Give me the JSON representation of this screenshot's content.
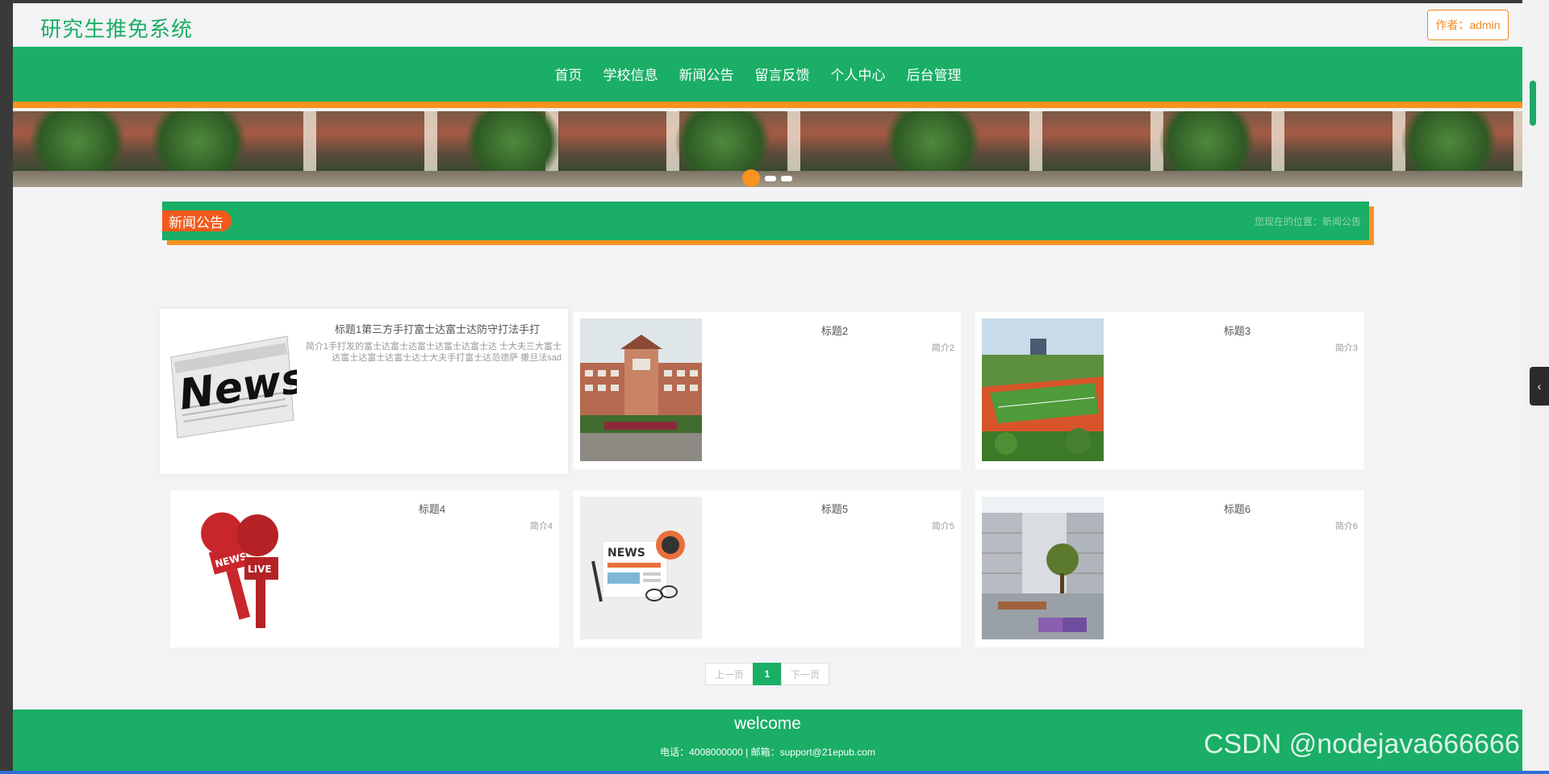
{
  "header": {
    "site_title": "研究生推免系统",
    "author_label": "作者：admin"
  },
  "nav": {
    "items": [
      "首页",
      "学校信息",
      "新闻公告",
      "留言反馈",
      "个人中心",
      "后台管理"
    ]
  },
  "banner": {
    "slide_count": 3,
    "active_index": 0
  },
  "section": {
    "tag": "新闻公告",
    "breadcrumb": "您现在的位置：新闻公告"
  },
  "news": [
    {
      "title": "标题1第三方手打富士达富士达防守打法手打",
      "summary": "简介1手打发的富士达富士达富士达富士达富士达 士大夫三大富士达富士达富士达富士达士大夫手打富士达范德萨 撒旦法sad",
      "thumb": "newspaper-icon"
    },
    {
      "title": "标题2",
      "summary": "简介2",
      "thumb": "school-building-photo"
    },
    {
      "title": "标题3",
      "summary": "简介3",
      "thumb": "sports-field-photo"
    },
    {
      "title": "标题4",
      "summary": "简介4",
      "thumb": "microphone-icon"
    },
    {
      "title": "标题5",
      "summary": "简介5",
      "thumb": "news-paper-glasses-icon"
    },
    {
      "title": "标题6",
      "summary": "简介6",
      "thumb": "campus-courtyard-photo"
    }
  ],
  "pager": {
    "prev": "上一页",
    "current": "1",
    "next": "下一页"
  },
  "footer": {
    "title": "welcome",
    "contact": "电话：4008000000 | 邮箱：support@21epub.com"
  },
  "watermark": "CSDN @nodejava666666",
  "colors": {
    "primary": "#1aae66",
    "accent": "#f7931e",
    "tag": "#f25a1c"
  }
}
